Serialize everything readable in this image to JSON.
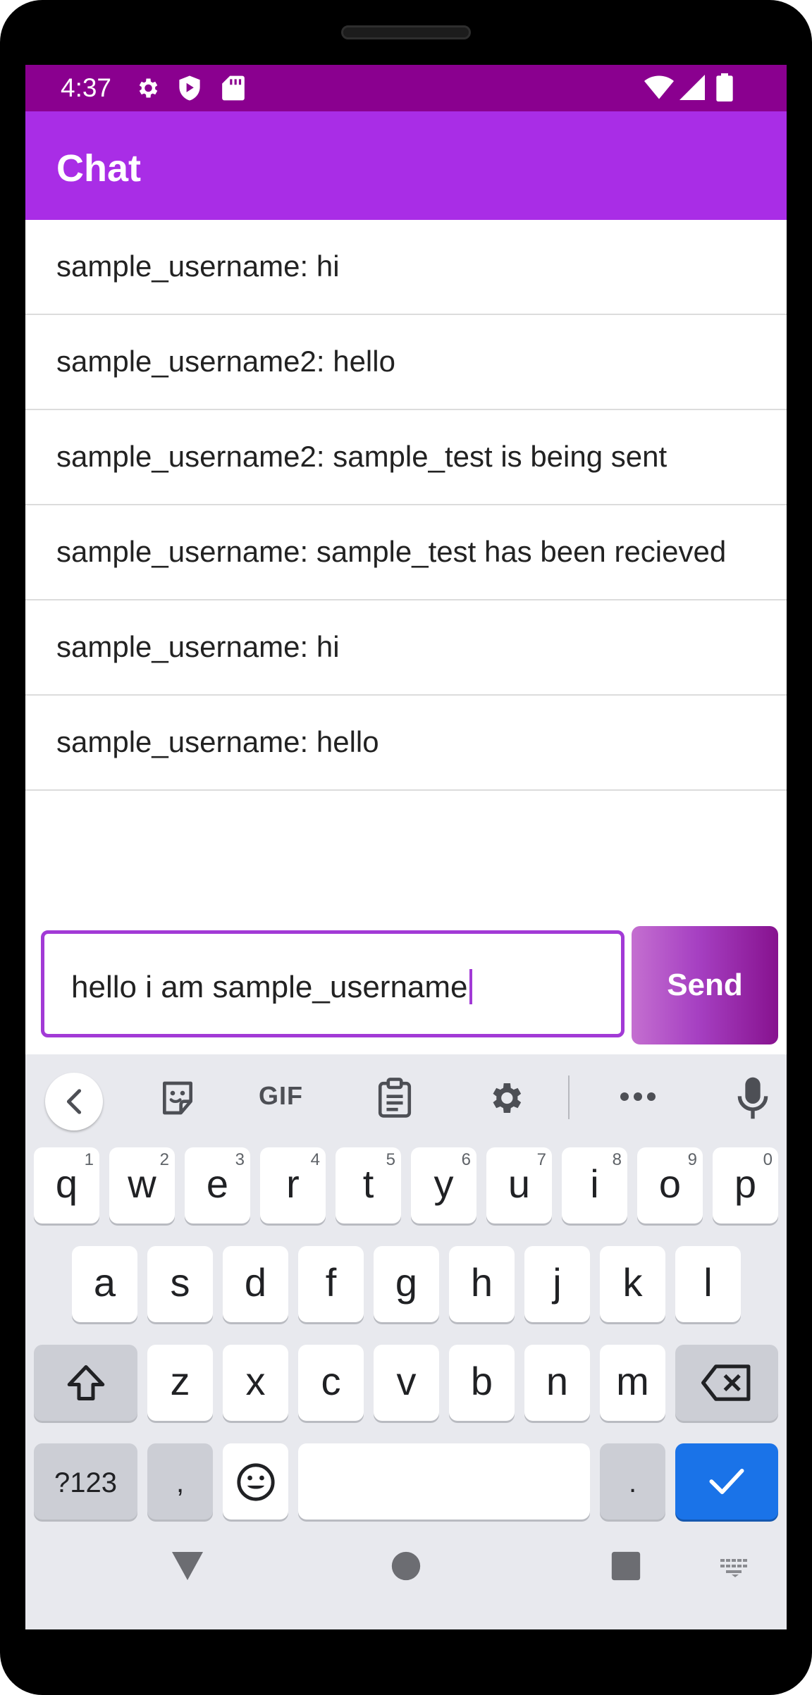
{
  "status_bar": {
    "time": "4:37",
    "left_icons": [
      "gear-icon",
      "shield-play-icon",
      "sd-card-icon"
    ],
    "right_icons": [
      "wifi-icon",
      "signal-icon",
      "battery-icon"
    ],
    "background": "#8a008f"
  },
  "app_bar": {
    "title": "Chat",
    "background": "#a92de6"
  },
  "messages": [
    {
      "text": "sample_username: hi"
    },
    {
      "text": "sample_username2: hello"
    },
    {
      "text": "sample_username2: sample_test is being sent"
    },
    {
      "text": "sample_username: sample_test has been recieved"
    },
    {
      "text": "sample_username: hi"
    },
    {
      "text": "sample_username: hello"
    }
  ],
  "composer": {
    "input_value": "hello i am sample_username",
    "send_label": "Send",
    "accent": "#a23ad6"
  },
  "keyboard": {
    "toolbar": {
      "gif_label": "GIF",
      "icons": [
        "back-chevron-icon",
        "sticker-icon",
        "gif-icon",
        "clipboard-icon",
        "settings-icon",
        "more-icon",
        "microphone-icon"
      ]
    },
    "row1": [
      {
        "label": "q",
        "hint": "1"
      },
      {
        "label": "w",
        "hint": "2"
      },
      {
        "label": "e",
        "hint": "3"
      },
      {
        "label": "r",
        "hint": "4"
      },
      {
        "label": "t",
        "hint": "5"
      },
      {
        "label": "y",
        "hint": "6"
      },
      {
        "label": "u",
        "hint": "7"
      },
      {
        "label": "i",
        "hint": "8"
      },
      {
        "label": "o",
        "hint": "9"
      },
      {
        "label": "p",
        "hint": "0"
      }
    ],
    "row2": [
      "a",
      "s",
      "d",
      "f",
      "g",
      "h",
      "j",
      "k",
      "l"
    ],
    "row3": [
      "z",
      "x",
      "c",
      "v",
      "b",
      "n",
      "m"
    ],
    "row4": {
      "symbols_label": "?123",
      "comma_label": ",",
      "period_label": "."
    },
    "enter_color": "#1a73e8"
  },
  "nav_bar": {
    "icons": [
      "back-triangle-icon",
      "home-circle-icon",
      "recents-square-icon",
      "keyboard-switch-icon"
    ]
  }
}
